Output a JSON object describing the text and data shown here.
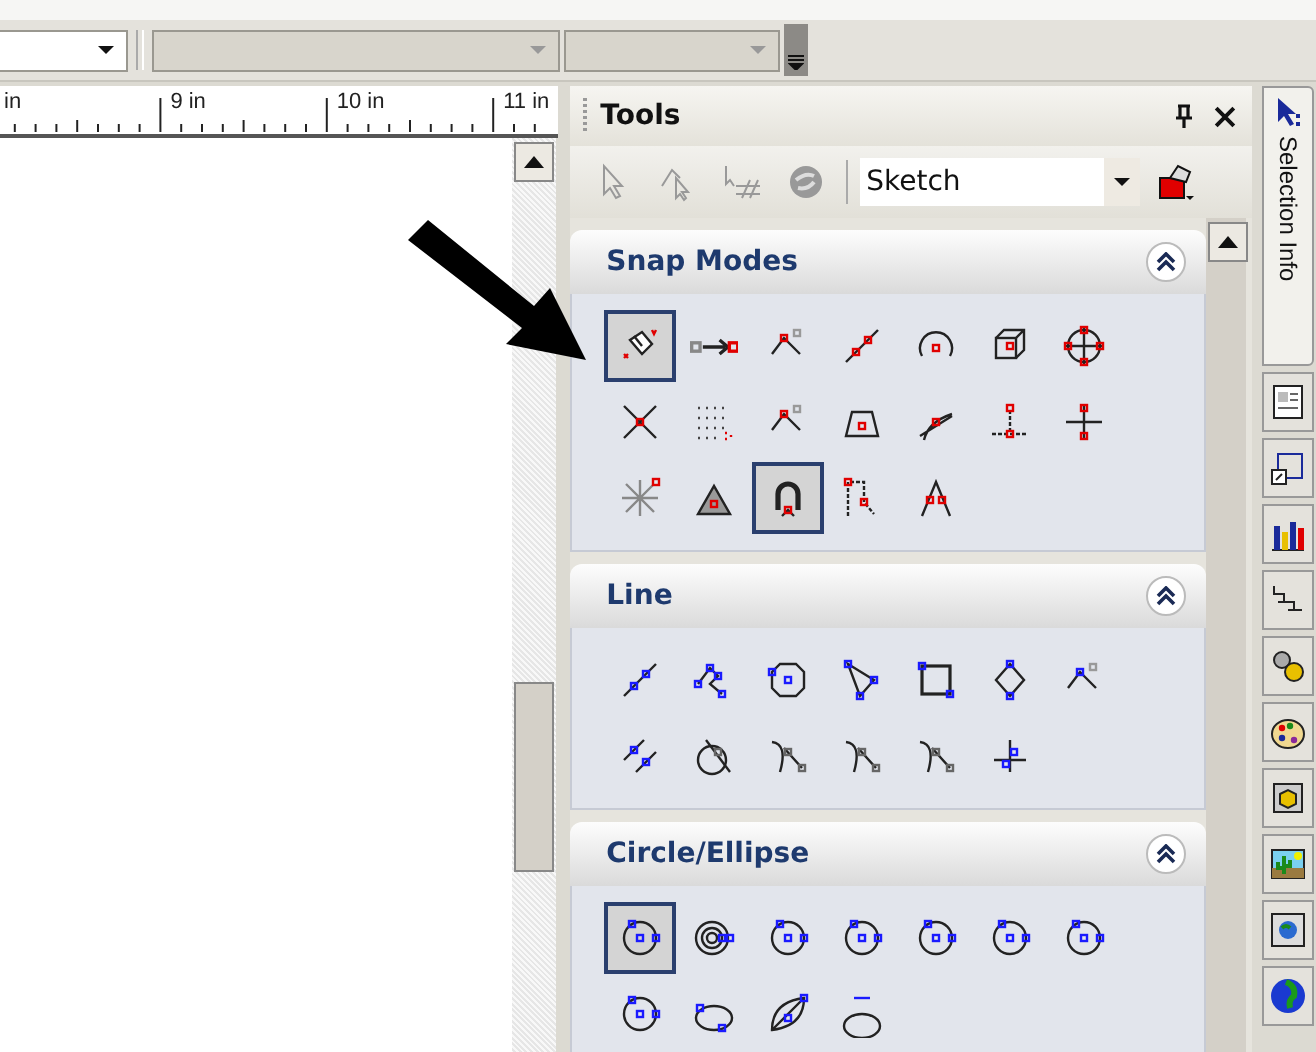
{
  "toolbar": {
    "combos": [
      {
        "disabled": false
      },
      {
        "disabled": true
      },
      {
        "disabled": true
      }
    ]
  },
  "ruler": {
    "labels": [
      "in",
      "9 in",
      "10 in",
      "11 in"
    ]
  },
  "tools_panel": {
    "title": "Tools",
    "mode": {
      "value": "Sketch"
    },
    "sections": [
      {
        "title": "Snap Modes",
        "kind": "snap",
        "expanded": true,
        "tools": [
          {
            "selected": true
          },
          {
            "selected": false
          },
          {
            "selected": false
          },
          {
            "selected": false
          },
          {
            "selected": false
          },
          {
            "selected": false
          },
          {
            "selected": false
          },
          {
            "selected": false
          },
          {
            "selected": false
          },
          {
            "selected": false
          },
          {
            "selected": false
          },
          {
            "selected": false
          },
          {
            "selected": false
          },
          {
            "selected": false
          },
          {
            "selected": false
          },
          {
            "selected": false
          },
          {
            "selected": true
          },
          {
            "selected": false
          },
          {
            "selected": false
          }
        ]
      },
      {
        "title": "Line",
        "kind": "line",
        "expanded": true,
        "tools": [
          {
            "selected": false
          },
          {
            "selected": false
          },
          {
            "selected": false
          },
          {
            "selected": false
          },
          {
            "selected": false
          },
          {
            "selected": false
          },
          {
            "selected": false
          },
          {
            "selected": false
          },
          {
            "selected": false
          },
          {
            "selected": false
          },
          {
            "selected": false
          },
          {
            "selected": false
          },
          {
            "selected": false
          }
        ]
      },
      {
        "title": "Circle/Ellipse",
        "kind": "circle",
        "expanded": true,
        "tools": [
          {
            "selected": true
          },
          {
            "selected": false
          },
          {
            "selected": false
          },
          {
            "selected": false
          },
          {
            "selected": false
          },
          {
            "selected": false
          },
          {
            "selected": false
          },
          {
            "selected": false
          },
          {
            "selected": false
          },
          {
            "selected": false
          },
          {
            "selected": false
          }
        ]
      }
    ]
  },
  "side_panel": {
    "tab": {
      "label": "Selection Info",
      "selected": true
    }
  }
}
